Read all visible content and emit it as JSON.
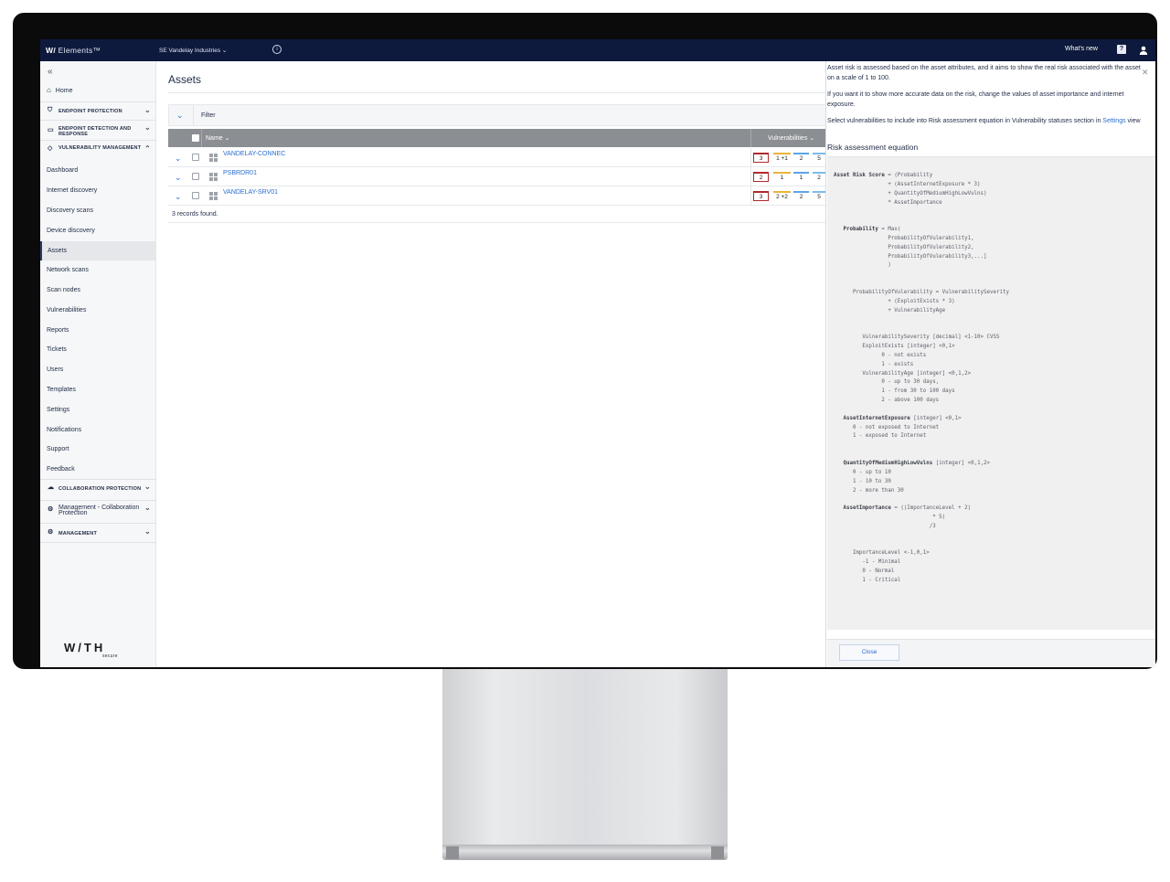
{
  "topbar": {
    "brand_mark": "W/",
    "brand_name": "Elements™",
    "org_selector": "SE Vandelay Industries",
    "whats_new": "What's new",
    "help_icon": "?"
  },
  "sidebar": {
    "home": "Home",
    "sections": {
      "endpoint_protection": "ENDPOINT PROTECTION",
      "edr": "ENDPOINT DETECTION AND RESPONSE",
      "vuln_mgmt": "VULNERABILITY MANAGEMENT",
      "collab_protection": "COLLABORATION PROTECTION",
      "mgmt_collab": "Management - Collaboration Protection",
      "management": "MANAGEMENT"
    },
    "items": [
      "Dashboard",
      "Internet discovery",
      "Discovery scans",
      "Device discovery",
      "Assets",
      "Network scans",
      "Scan nodes",
      "Vulnerabilities",
      "Reports",
      "Tickets",
      "Users",
      "Templates",
      "Settings",
      "Notifications",
      "Support",
      "Feedback"
    ],
    "active_item": "Assets",
    "logo_text": "W/TH",
    "logo_sub": "secure"
  },
  "main": {
    "title": "Assets",
    "filter_label": "Filter",
    "columns": {
      "name": "Name",
      "vulnerabilities": "Vulnerabilities"
    },
    "rows": [
      {
        "name": "VANDELAY-CONNEC",
        "critical": "3",
        "high": "1 +1",
        "medium": "2",
        "low": "5"
      },
      {
        "name": "PSBRDR01",
        "critical": "2",
        "high": "1",
        "medium": "1",
        "low": "2"
      },
      {
        "name": "VANDELAY-SRV01",
        "critical": "3",
        "high": "2 +2",
        "medium": "2",
        "low": "5"
      }
    ],
    "records_found": "3 records found."
  },
  "panel": {
    "intro": "Asset risk is assessed based on the asset attributes, and it aims to show the real risk associated with the asset on a scale of 1 to 100.",
    "accuracy": "If you want it to show more accurate data on the risk, change the values of asset importance and internet exposure.",
    "select_vulns_prefix": "Select vulnerabilities to include into Risk assessment equation in Vulnerability statuses section in",
    "settings_link": "Settings",
    "select_vulns_suffix": "view",
    "equation_title": "Risk assessment equation",
    "equation_lines": [
      [
        "Asset Risk Score",
        " = (Probability"
      ],
      [
        "",
        "                 + (AssetInternetExposure * 3)"
      ],
      [
        "",
        "                 + QuantityOfMediumHighLowVulns)"
      ],
      [
        "",
        "                 * AssetImportance"
      ],
      [
        "",
        ""
      ],
      [
        "",
        ""
      ],
      [
        "   Probability",
        " = Max("
      ],
      [
        "",
        "                 ProbabilityOfVulerability1,"
      ],
      [
        "",
        "                 ProbabilityOfVulerability2,"
      ],
      [
        "",
        "                 ProbabilityOfVulerability3,...]"
      ],
      [
        "",
        "                 )"
      ],
      [
        "",
        ""
      ],
      [
        "",
        ""
      ],
      [
        "",
        "      ProbabilityOfVulerability = VulnerabilitySeverity"
      ],
      [
        "",
        "                 + (ExploitExists * 3)"
      ],
      [
        "",
        "                 + VulnerabilityAge"
      ],
      [
        "",
        ""
      ],
      [
        "",
        ""
      ],
      [
        "",
        "         VulnerabilitySeverity [decimal] <1-10> CVSS"
      ],
      [
        "",
        "         ExploitExists [integer] <0,1>"
      ],
      [
        "",
        "               0 - not exists"
      ],
      [
        "",
        "               1 - exists"
      ],
      [
        "",
        "         VulnerabilityAge [integer] <0,1,2>"
      ],
      [
        "",
        "               0 - up to 30 days,"
      ],
      [
        "",
        "               1 - from 30 to 100 days"
      ],
      [
        "",
        "               2 - above 100 days"
      ],
      [
        "",
        ""
      ],
      [
        "   AssetInternetExposure",
        " [integer] <0,1>"
      ],
      [
        "",
        "      0 - not exposed to Internet"
      ],
      [
        "",
        "      1 - exposed to Internet"
      ],
      [
        "",
        ""
      ],
      [
        "",
        ""
      ],
      [
        "   QuantityOfMediumHighLowVulns",
        " [integer] <0,1,2>"
      ],
      [
        "",
        "      0 - up to 10"
      ],
      [
        "",
        "      1 - 10 to 30"
      ],
      [
        "",
        "      2 - more than 30"
      ],
      [
        "",
        ""
      ],
      [
        "   AssetImportance",
        " = ((ImportanceLevel + 2)"
      ],
      [
        "",
        "                               * 5)"
      ],
      [
        "",
        "                              /3"
      ],
      [
        "",
        ""
      ],
      [
        "",
        ""
      ],
      [
        "",
        "      ImportanceLevel <-1,0,1>"
      ],
      [
        "",
        "         -1 - Minimal"
      ],
      [
        "",
        "         0 - Normal"
      ],
      [
        "",
        "         1 - Critical"
      ]
    ],
    "close_label": "Close"
  }
}
